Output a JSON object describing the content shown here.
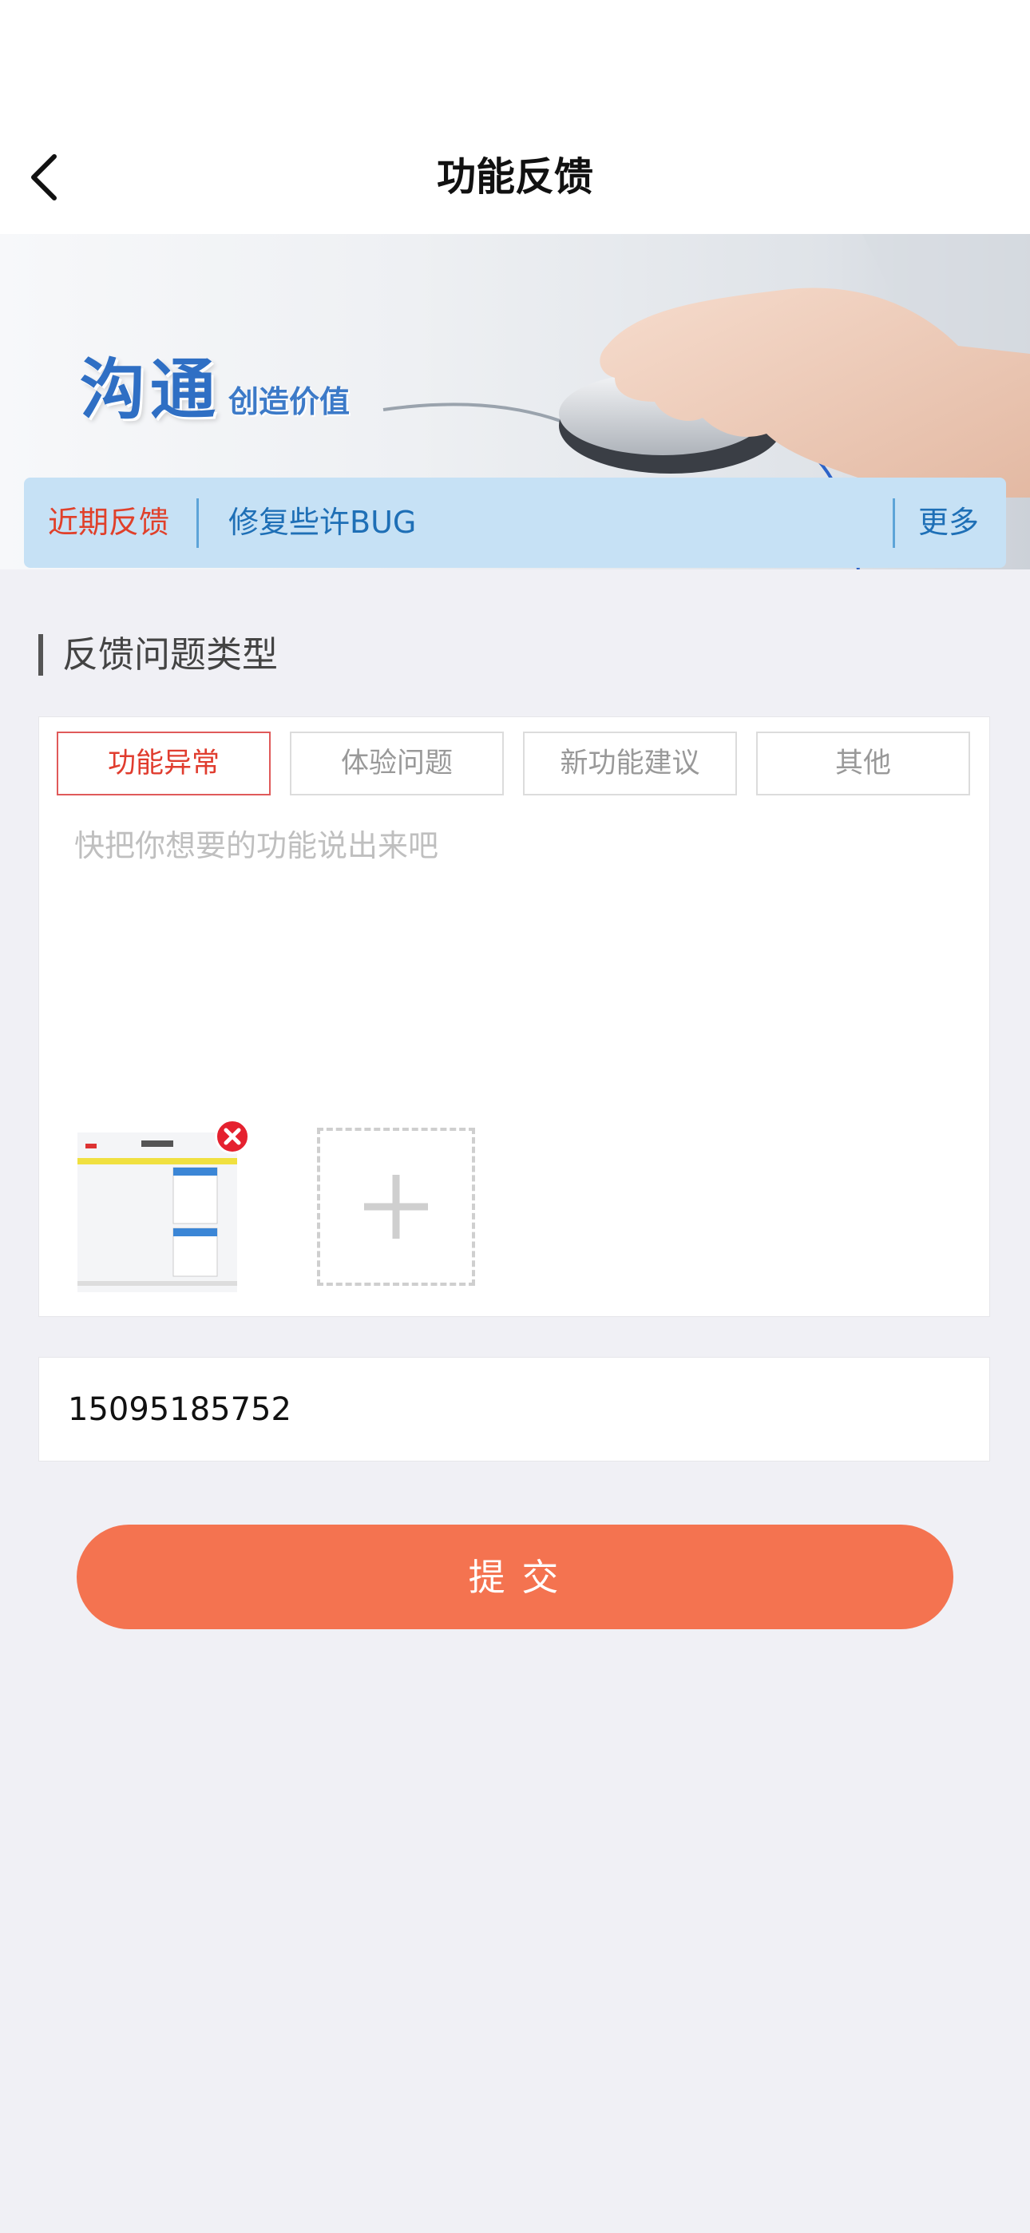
{
  "nav": {
    "title": "功能反馈"
  },
  "banner": {
    "logo_main": "沟通",
    "logo_sub": "创造价值"
  },
  "notice": {
    "label": "近期反馈",
    "text": "修复些许BUG",
    "more": "更多"
  },
  "section": {
    "title": "反馈问题类型"
  },
  "tabs": [
    {
      "label": "功能异常",
      "active": true
    },
    {
      "label": "体验问题",
      "active": false
    },
    {
      "label": "新功能建议",
      "active": false
    },
    {
      "label": "其他",
      "active": false
    }
  ],
  "feedback": {
    "placeholder": "快把你想要的功能说出来吧",
    "value": ""
  },
  "contact": {
    "value": "15095185752"
  },
  "submit": {
    "label": "提 交"
  },
  "colors": {
    "accent": "#f47350",
    "notice_bg": "#c6e1f5",
    "active_tab": "#e03c2e",
    "link": "#1e6fb6"
  }
}
